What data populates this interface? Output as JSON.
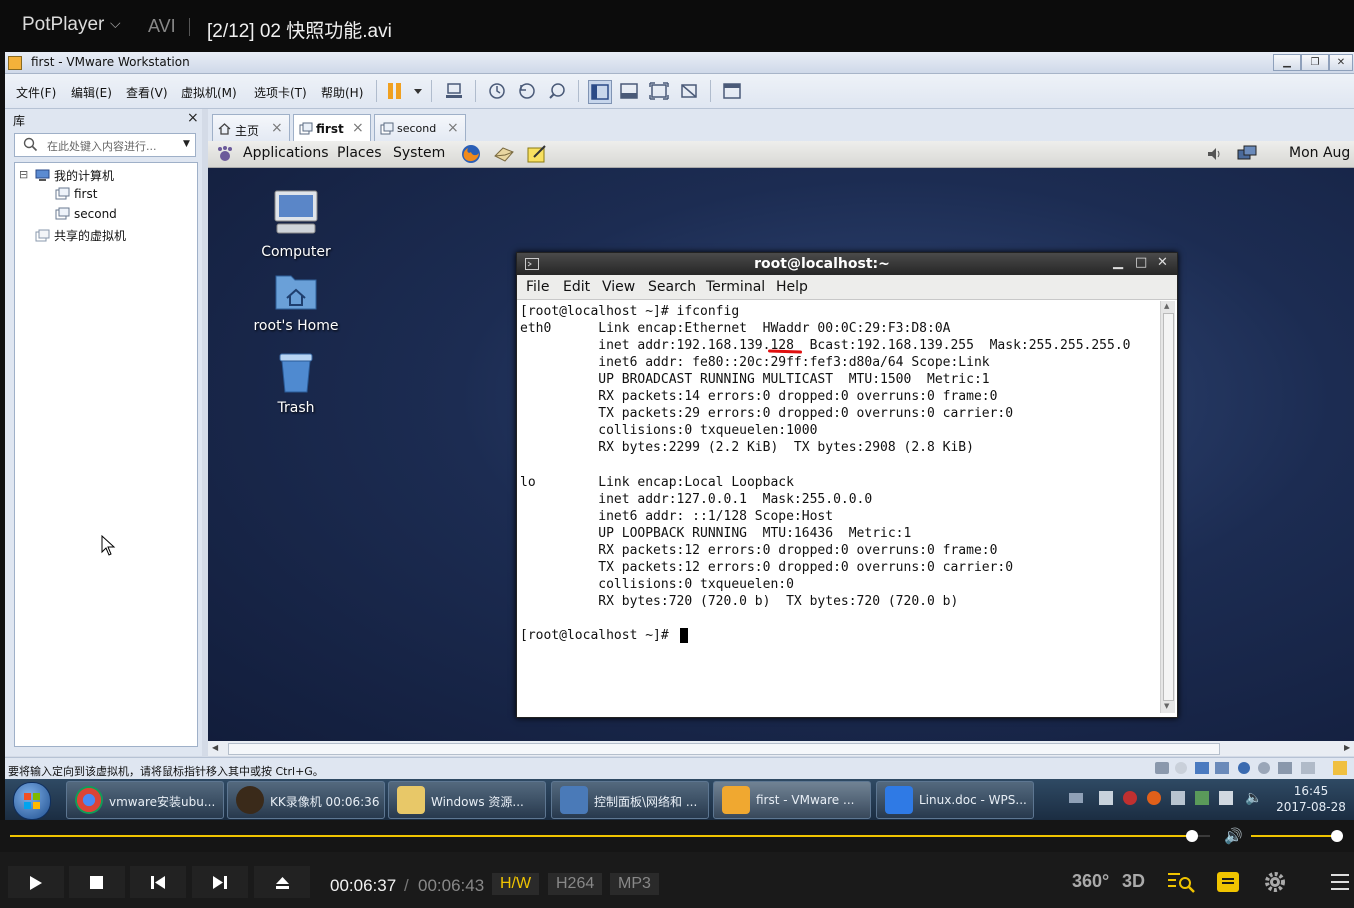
{
  "player": {
    "brand": "PotPlayer",
    "format": "AVI",
    "file_title": "[2/12] 02 快照功能.avi",
    "time_current": "00:06:37",
    "time_separator": "/",
    "time_total": "00:06:43",
    "hw_badge": "H/W",
    "video_codec": "H264",
    "audio_codec": "MP3",
    "progress_fraction": 0.985,
    "volume_fraction": 1.0,
    "accent_color": "#f0c400"
  },
  "vmware": {
    "window_title": "first - VMware Workstation",
    "menu": [
      "文件(F)",
      "编辑(E)",
      "查看(V)",
      "虚拟机(M)",
      "选项卡(T)",
      "帮助(H)"
    ],
    "library": {
      "header": "库",
      "close": "×",
      "search_placeholder": "在此处键入内容进行...",
      "tree": {
        "root": "我的计算机",
        "vm1": "first",
        "vm2": "second",
        "shared": "共享的虚拟机"
      }
    },
    "tabs": [
      {
        "label": "主页",
        "close": "×"
      },
      {
        "label": "first",
        "close": "×"
      },
      {
        "label": "second",
        "close": "×"
      }
    ],
    "status_text": "要将输入定向到该虚拟机，请将鼠标指针移入其中或按 Ctrl+G。"
  },
  "guest": {
    "menu": [
      "Applications",
      "Places",
      "System"
    ],
    "clock_partial": "Mon Aug",
    "desktop_icons": [
      "Computer",
      "root's Home",
      "Trash"
    ],
    "terminal": {
      "title": "root@localhost:~",
      "menu": [
        "File",
        "Edit",
        "View",
        "Search",
        "Terminal",
        "Help"
      ],
      "lines": [
        "[root@localhost ~]# ifconfig",
        "eth0      Link encap:Ethernet  HWaddr 00:0C:29:F3:D8:0A",
        "          inet addr:192.168.139.128  Bcast:192.168.139.255  Mask:255.255.255.0",
        "          inet6 addr: fe80::20c:29ff:fef3:d80a/64 Scope:Link",
        "          UP BROADCAST RUNNING MULTICAST  MTU:1500  Metric:1",
        "          RX packets:14 errors:0 dropped:0 overruns:0 frame:0",
        "          TX packets:29 errors:0 dropped:0 overruns:0 carrier:0",
        "          collisions:0 txqueuelen:1000",
        "          RX bytes:2299 (2.2 KiB)  TX bytes:2908 (2.8 KiB)",
        "",
        "lo        Link encap:Local Loopback",
        "          inet addr:127.0.0.1  Mask:255.0.0.0",
        "          inet6 addr: ::1/128 Scope:Host",
        "          UP LOOPBACK RUNNING  MTU:16436  Metric:1",
        "          RX packets:12 errors:0 dropped:0 overruns:0 frame:0",
        "          TX packets:12 errors:0 dropped:0 overruns:0 carrier:0",
        "          collisions:0 txqueuelen:0",
        "          RX bytes:720 (720.0 b)  TX bytes:720 (720.0 b)",
        "",
        "[root@localhost ~]# "
      ]
    }
  },
  "taskbar": {
    "items": [
      "vmware安装ubu...",
      "KK录像机 00:06:36",
      "Windows 资源...",
      "控制面板\\网络和 ...",
      "first - VMware ...",
      "Linux.doc - WPS..."
    ],
    "time": "16:45",
    "date": "2017-08-28"
  },
  "player_right_buttons": [
    "360°",
    "3D"
  ]
}
